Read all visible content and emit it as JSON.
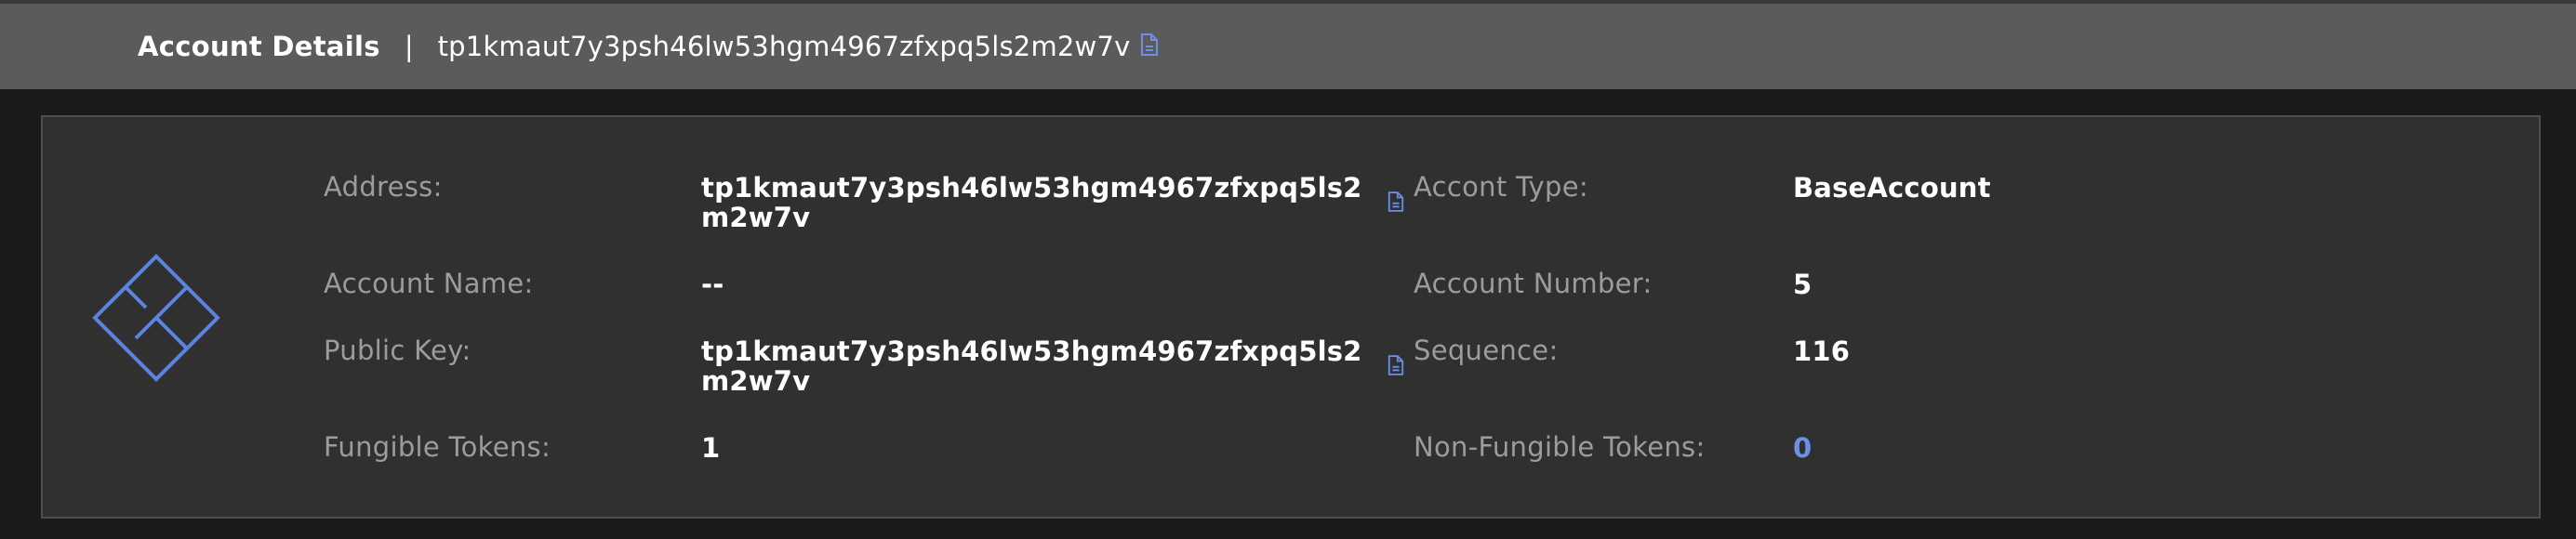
{
  "header": {
    "title": "Account Details",
    "separator": "|",
    "address": "tp1kmaut7y3psh46lw53hgm4967zfxpq5ls2m2w7v",
    "copy_icon": "copy-icon"
  },
  "details": {
    "address_label": "Address:",
    "address_value": "tp1kmaut7y3psh46lw53hgm4967zfxpq5ls2m2w7v",
    "account_name_label": "Account Name:",
    "account_name_value": "--",
    "public_key_label": "Public Key:",
    "public_key_value": "tp1kmaut7y3psh46lw53hgm4967zfxpq5ls2m2w7v",
    "fungible_tokens_label": "Fungible Tokens:",
    "fungible_tokens_value": "1",
    "account_type_label": "Accont Type:",
    "account_type_value": "BaseAccount",
    "account_number_label": "Account Number:",
    "account_number_value": "5",
    "sequence_label": "Sequence:",
    "sequence_value": "116",
    "non_fungible_tokens_label": "Non-Fungible Tokens:",
    "non_fungible_tokens_value": "0"
  },
  "colors": {
    "accent": "#6d8fe6",
    "header_bg": "#5b5b5b",
    "card_bg": "#303030",
    "page_bg": "#1b1b1b",
    "label": "#9c9c9c"
  },
  "icons": {
    "logo": "account-logo-icon",
    "copy": "copy-icon"
  }
}
